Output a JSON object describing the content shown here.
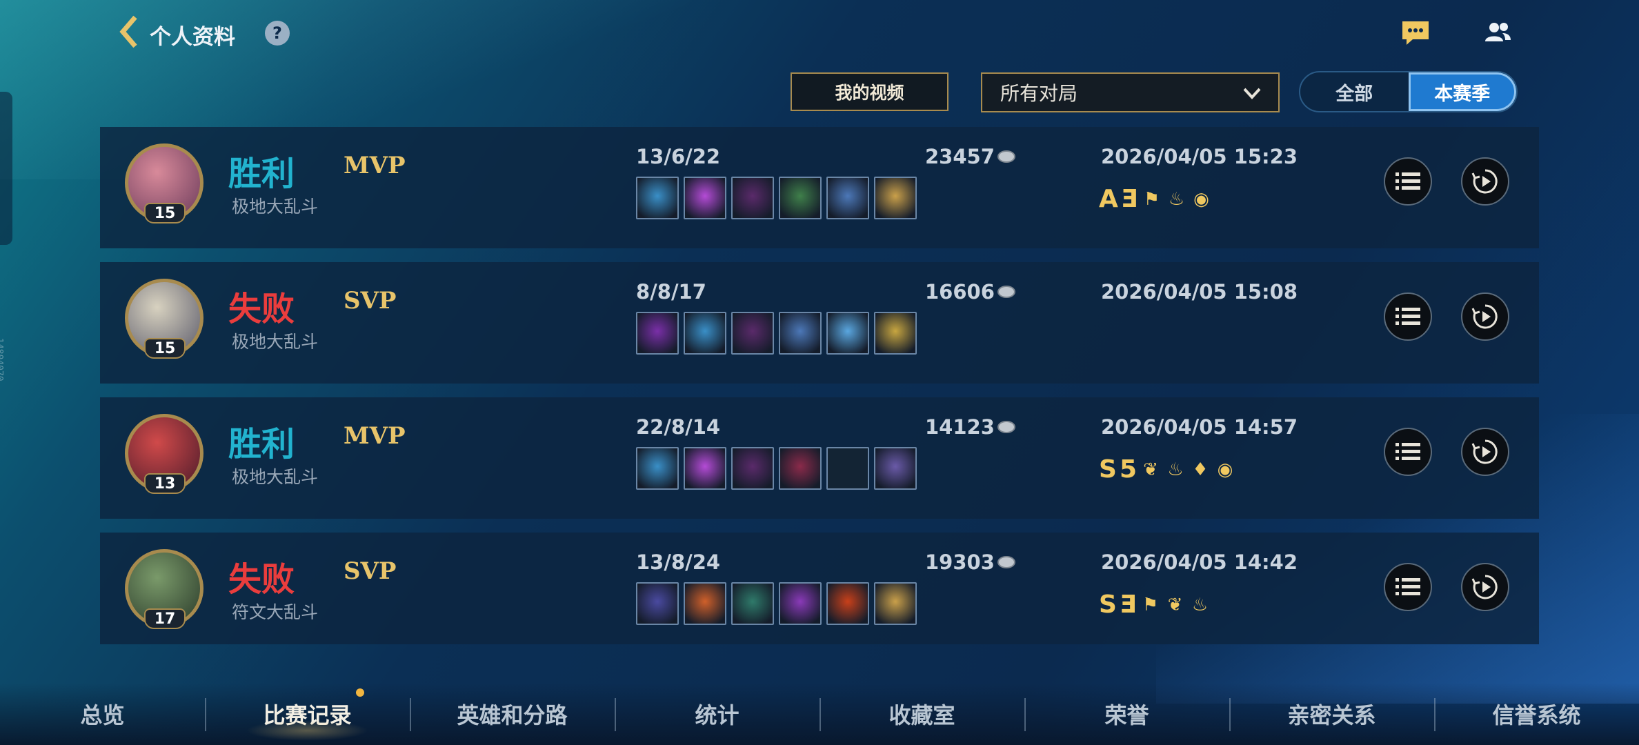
{
  "header": {
    "title": "个人资料",
    "help": "?"
  },
  "filters": {
    "video_button": "我的视频",
    "mode_dropdown": "所有对局",
    "segments": [
      "全部",
      "本赛季"
    ],
    "active_segment": "本赛季"
  },
  "matches": [
    {
      "result": "胜利",
      "outcome": "win",
      "badge": "MVP",
      "mode": "极地大乱斗",
      "level": "15",
      "kda": "13/6/22",
      "gold": "23457",
      "date": "2026/04/05 15:23",
      "grades": [
        "A",
        "Ǝ"
      ],
      "achievements": [
        "flag-icon",
        "flame-icon",
        "coins-icon"
      ],
      "items": [
        "#3a8fc7",
        "#b44bd6",
        "#5a2a6a",
        "#3f7f4a",
        "#4c78b8",
        "#caa04a"
      ]
    },
    {
      "result": "失败",
      "outcome": "loss",
      "badge": "SVP",
      "mode": "极地大乱斗",
      "level": "15",
      "kda": "8/8/17",
      "gold": "16606",
      "date": "2026/04/05 15:08",
      "grades": [],
      "achievements": [],
      "items": [
        "#7a2fa8",
        "#3a8fc7",
        "#5a2a6a",
        "#4c78b8",
        "#5aa7e0",
        "#c8a640"
      ]
    },
    {
      "result": "胜利",
      "outcome": "win",
      "badge": "MVP",
      "mode": "极地大乱斗",
      "level": "13",
      "kda": "22/8/14",
      "gold": "14123",
      "date": "2026/04/05 14:57",
      "grades": [
        "S",
        "5"
      ],
      "achievements": [
        "leaf-flame-icon",
        "flame-icon",
        "drop-icon",
        "coins-icon"
      ],
      "items": [
        "#3a8fc7",
        "#b44bd6",
        "#5a2a6a",
        "#8a2a4a",
        "",
        "#6a5aa8"
      ]
    },
    {
      "result": "失败",
      "outcome": "loss",
      "badge": "SVP",
      "mode": "符文大乱斗",
      "level": "17",
      "kda": "13/8/24",
      "gold": "19303",
      "date": "2026/04/05 14:42",
      "grades": [
        "S",
        "Ǝ"
      ],
      "achievements": [
        "flag-icon",
        "leaf-flame-icon",
        "flame-icon"
      ],
      "items": [
        "#4a4aa0",
        "#d0602a",
        "#2f7a6a",
        "#8a3ab8",
        "#c8401a",
        "#caa04a"
      ]
    }
  ],
  "nav": [
    "总览",
    "比赛记录",
    "英雄和分路",
    "统计",
    "收藏室",
    "荣誉",
    "亲密关系",
    "信誉系统"
  ],
  "nav_active": "比赛记录",
  "side_id": "14804070",
  "colors": {
    "win": "#22b3cf",
    "loss": "#ea3d3d",
    "gold_accent": "#a88b4e",
    "active_tab": "#1f7ad0"
  }
}
